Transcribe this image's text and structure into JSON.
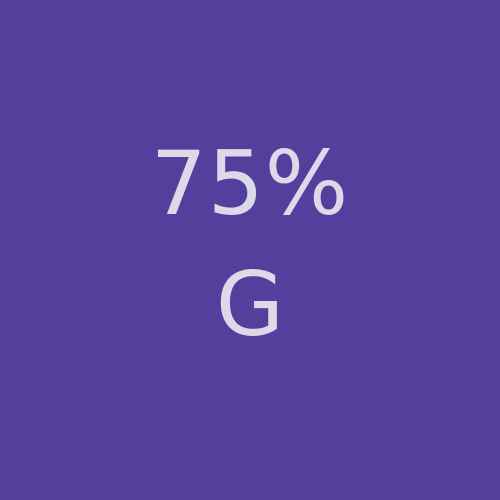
{
  "tile": {
    "background_color": "#553f9d",
    "text_color": "#dcd9e8",
    "percent_text": "75%",
    "grade_text": "G"
  }
}
